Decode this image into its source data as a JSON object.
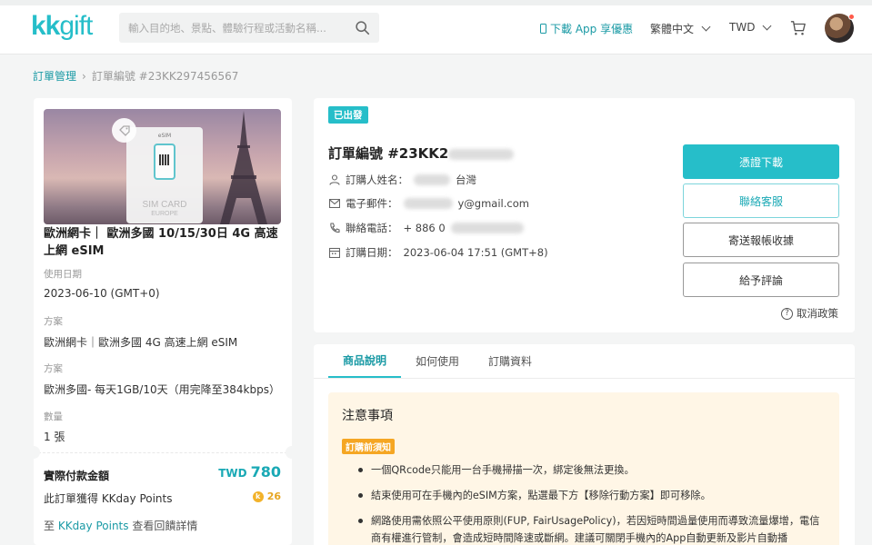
{
  "header": {
    "logo_kk": "kk",
    "logo_gift": "gift",
    "search_placeholder": "輸入目的地、景點、體驗行程或活動名稱...",
    "app_download": "下載 App 享優惠",
    "language": "繁體中文",
    "currency": "TWD"
  },
  "breadcrumb": {
    "parent": "訂單管理",
    "current": "訂單編號 #23KK297456567"
  },
  "product": {
    "image_sim_text": "SIM CARD",
    "image_sim_sub": "EUROPE",
    "image_esim_label": "eSIM",
    "title": "歐洲網卡｜ 歐洲多國 10/15/30日 4G 高速上網 eSIM",
    "fields": [
      {
        "label": "使用日期",
        "value": "2023-06-10 (GMT+0)"
      },
      {
        "label": "方案",
        "value": "歐洲網卡｜歐洲多國 4G 高速上網 eSIM"
      },
      {
        "label": "方案",
        "value": "歐洲多國- 每天1GB/10天（用完降至384kbps）"
      },
      {
        "label": "數量",
        "value": "1 張"
      }
    ]
  },
  "payment": {
    "label": "實際付款金額",
    "currency": "TWD",
    "amount": "780",
    "points_label": "此訂單獲得 KKday Points",
    "points_value": "26",
    "points_link_prefix": "至 ",
    "points_link": "KKday Points",
    "points_link_suffix": " 查看回饋詳情"
  },
  "order": {
    "status": "已出發",
    "number_prefix": "訂單編號 #23KK2",
    "buyer_label": "訂購人姓名：",
    "buyer_suffix": "台灣",
    "email_label": "電子郵件：",
    "email_suffix": "y@gmail.com",
    "phone_label": "聯絡電話：",
    "phone_prefix": "+ 886 0",
    "date_label": "訂購日期：",
    "date_value": "2023-06-04 17:51 (GMT+8)"
  },
  "actions": {
    "voucher": "憑證下載",
    "contact": "聯絡客服",
    "receipt": "寄送報帳收據",
    "review": "給予評論",
    "cancel_policy": "取消政策"
  },
  "tabs": [
    "商品說明",
    "如何使用",
    "訂購資料"
  ],
  "notice": {
    "title": "注意事項",
    "badge": "訂購前須知",
    "items": [
      "一個QRcode只能用一台手機掃描一次，綁定後無法更換。",
      "結束使用可在手機內的eSIM方案，點選最下方【移除行動方案】即可移除。",
      "網路使用需依照公平使用原則(FUP, FairUsagePolicy)，若因短時間過量使用而導致流量爆增，電信商有權進行管制，會造成短時間降速或斷網。建議可關閉手機內的App自動更新及影片自動播"
    ]
  },
  "colors": {
    "brand": "#26bec9",
    "brand_dark": "#1a9aa5",
    "points": "#f2b22a",
    "notice_bg": "#fff6e6",
    "notice_badge": "#f5a623"
  }
}
